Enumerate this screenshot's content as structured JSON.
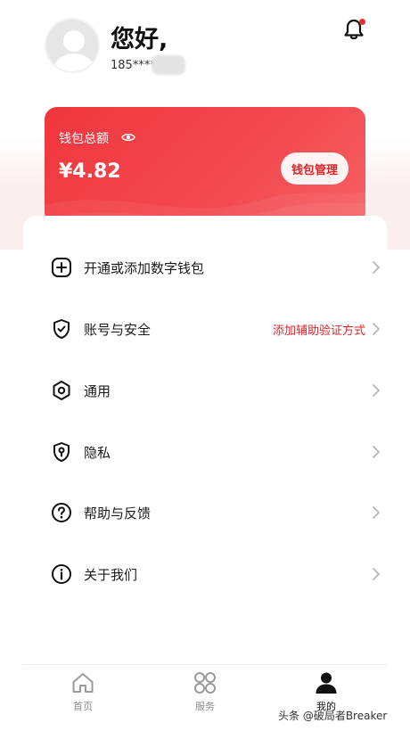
{
  "header": {
    "greeting": "您好,",
    "phone": "185****"
  },
  "wallet": {
    "title": "钱包总额",
    "amount": "¥4.82",
    "manage_label": "钱包管理"
  },
  "menu": [
    {
      "label": "开通或添加数字钱包",
      "icon": "plus-square-icon",
      "hint": ""
    },
    {
      "label": "账号与安全",
      "icon": "shield-check-icon",
      "hint": "添加辅助验证方式"
    },
    {
      "label": "通用",
      "icon": "hexagon-gear-icon",
      "hint": ""
    },
    {
      "label": "隐私",
      "icon": "privacy-shield-icon",
      "hint": ""
    },
    {
      "label": "帮助与反馈",
      "icon": "help-icon",
      "hint": ""
    },
    {
      "label": "关于我们",
      "icon": "info-icon",
      "hint": ""
    }
  ],
  "nav": {
    "tabs": [
      {
        "label": "首页",
        "icon": "home-icon"
      },
      {
        "label": "服务",
        "icon": "grid-icon"
      },
      {
        "label": "我的",
        "icon": "user-icon"
      }
    ],
    "active": "我的"
  },
  "watermark": "头条 @破局者Breaker",
  "colors": {
    "accent": "#e8312f",
    "hint_red": "#d9262c"
  }
}
